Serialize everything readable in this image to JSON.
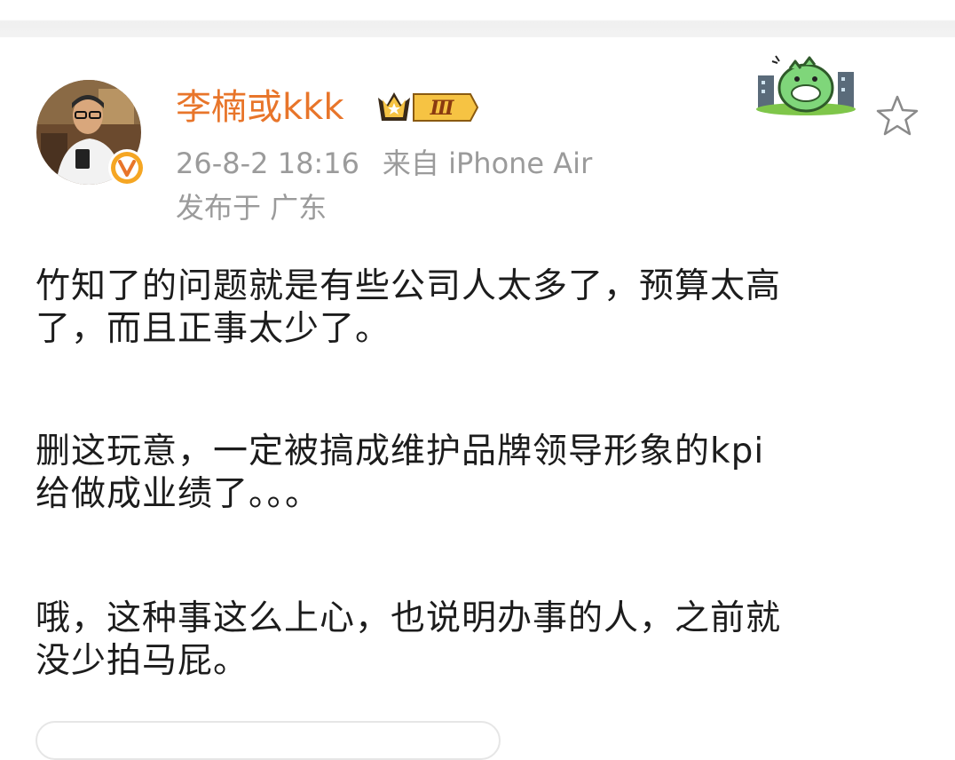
{
  "post": {
    "author": "李楠或kkk",
    "vip_level": "Ⅲ",
    "time": "26-8-2 18:16",
    "source": "来自 iPhone Air",
    "location": "发布于 广东",
    "paragraphs": [
      [
        "竹知了的问题就是有些公司人太多了，预算太高",
        "了，而且正事太少了。"
      ],
      [
        "删这玩意，一定被搞成维护品牌领导形象的kpi",
        "给做成业绩了。。。"
      ],
      [
        "哦，这种事这么上心，也说明办事的人，之前就",
        "没少拍马屁。"
      ]
    ]
  },
  "icons": {
    "avatar": "avatar-photo",
    "verified": "verified-v-icon",
    "vip": "crown-vip-icon",
    "sticker": "dinosaur-sticker",
    "favorite": "star-outline-icon"
  },
  "colors": {
    "username": "#e8752a",
    "meta": "#9b9b9b",
    "text": "#1c1c1c",
    "verified": "#f5a623"
  }
}
